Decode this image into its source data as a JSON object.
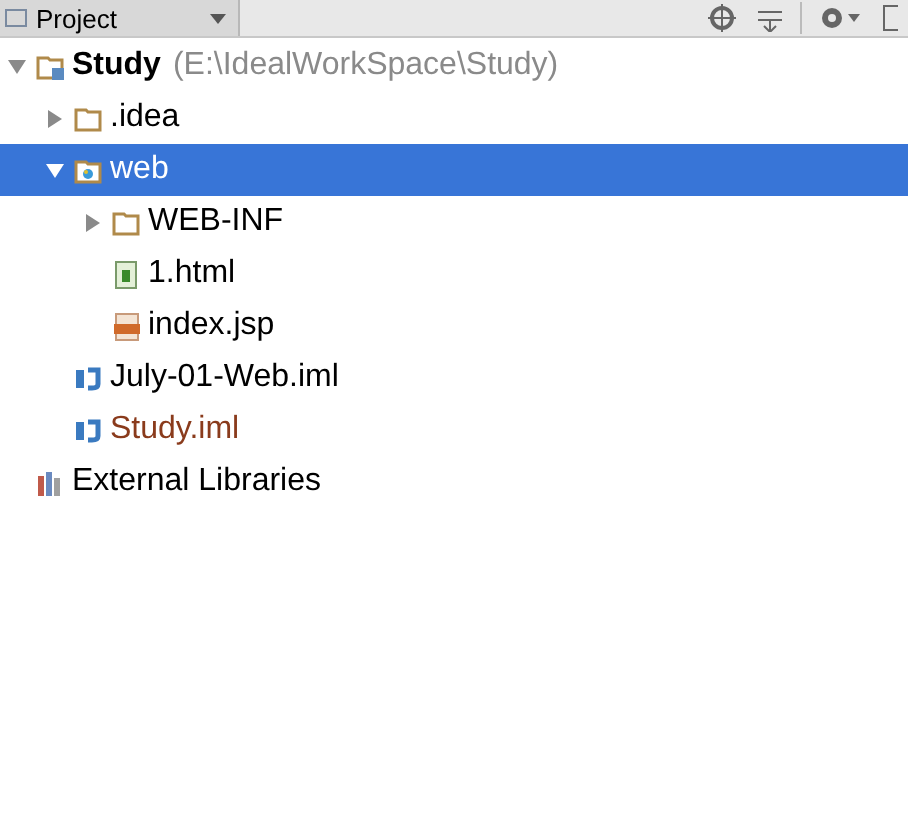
{
  "toolbar": {
    "title": "Project"
  },
  "tree": [
    {
      "label": "Study",
      "hint": "(E:\\IdealWorkSpace\\Study)",
      "kind": "module",
      "expanded": true,
      "selected": false,
      "color": "#000000",
      "children": [
        {
          "label": ".idea",
          "kind": "folder",
          "expanded": false,
          "selected": false,
          "color": "#000000"
        },
        {
          "label": "web",
          "kind": "web-folder",
          "expanded": true,
          "selected": true,
          "children": [
            {
              "label": "WEB-INF",
              "kind": "folder",
              "expanded": false,
              "selected": false,
              "color": "#000000"
            },
            {
              "label": "1.html",
              "kind": "html",
              "selected": false,
              "color": "#000000"
            },
            {
              "label": "index.jsp",
              "kind": "jsp",
              "selected": false,
              "color": "#000000"
            }
          ]
        },
        {
          "label": "July-01-Web.iml",
          "kind": "iml",
          "selected": false,
          "color": "#000000"
        },
        {
          "label": "Study.iml",
          "kind": "iml",
          "selected": false,
          "color": "#8a3b1c"
        }
      ]
    },
    {
      "label": "External Libraries",
      "kind": "library",
      "selected": false,
      "color": "#000000"
    }
  ]
}
